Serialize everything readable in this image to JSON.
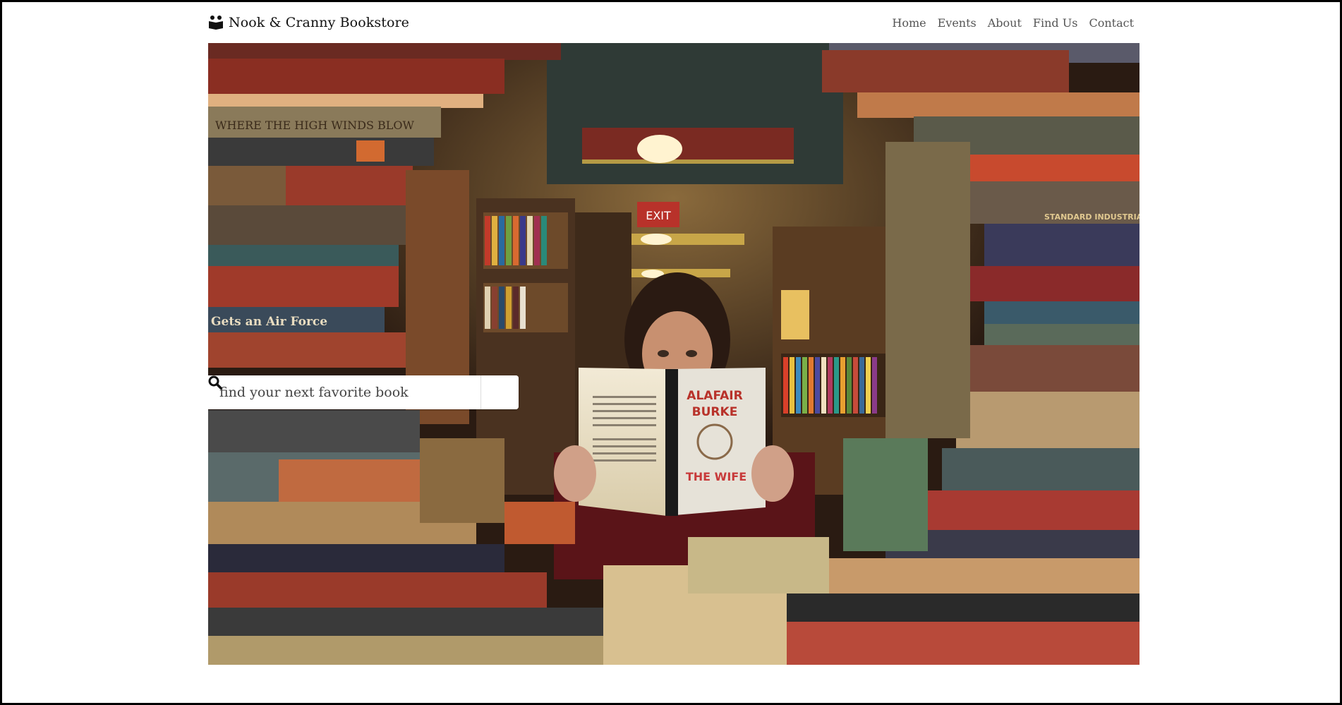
{
  "brand": {
    "name": "Nook & Cranny Bookstore",
    "icon": "reader-icon"
  },
  "nav": {
    "items": [
      {
        "label": "Home"
      },
      {
        "label": "Events"
      },
      {
        "label": "About"
      },
      {
        "label": "Find Us"
      },
      {
        "label": "Contact"
      }
    ]
  },
  "hero": {
    "image": "photo of a woman reading a book behind stacks of old books",
    "book_title": "THE WIFE",
    "book_author_line1": "ALAFAIR",
    "book_author_line2": "BURKE",
    "exit_sign": "EXIT",
    "spine_text_1": "WHERE THE HIGH WINDS BLOW",
    "spine_text_2": "Gets an Air Force",
    "spine_text_3": "STANDARD INDUSTRIAL CLASS"
  },
  "search": {
    "placeholder": "find your next favorite book",
    "icon": "search-icon"
  },
  "colors": {
    "nav_text": "#555555",
    "brand_text": "#111111",
    "frame": "#000000"
  }
}
